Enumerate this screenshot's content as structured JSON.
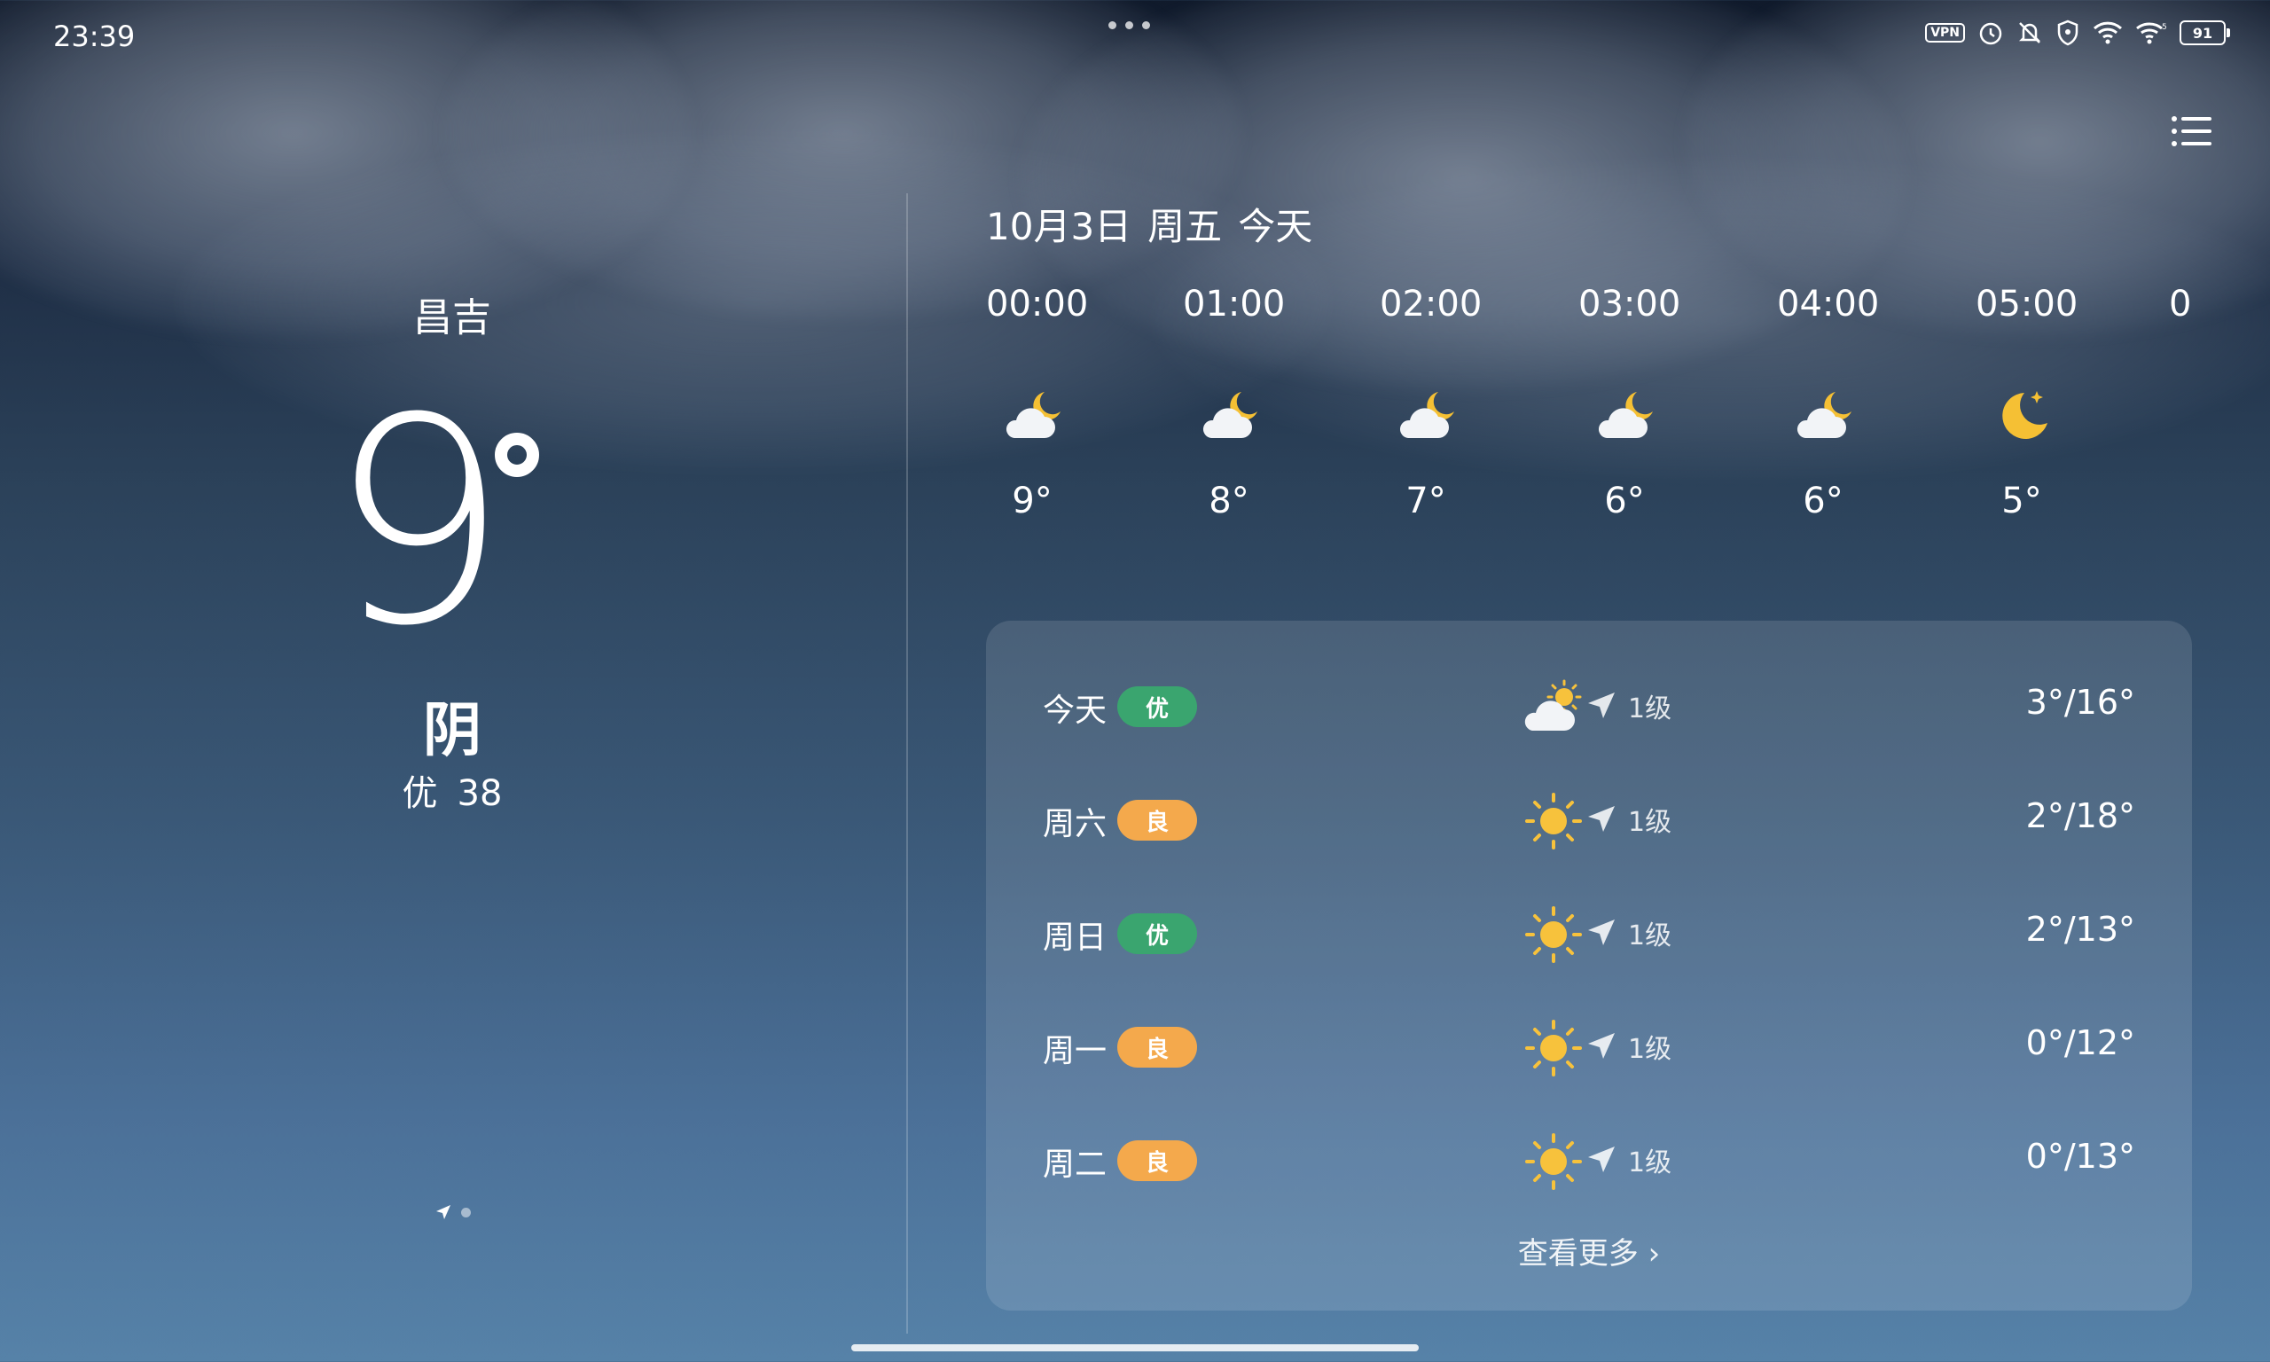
{
  "status_bar": {
    "time": "23:39",
    "battery": "91",
    "vpn": "VPN",
    "icons": [
      "vpn-icon",
      "alarm-icon",
      "mute-icon",
      "shield-icon",
      "wifi-icon",
      "wifi-5g-icon",
      "battery-icon"
    ]
  },
  "current": {
    "city": "昌吉",
    "temperature": "9",
    "condition": "阴",
    "aqi_label": "优",
    "aqi_value": "38"
  },
  "date_header": {
    "date": "10月3日",
    "weekday": "周五",
    "relative": "今天"
  },
  "hourly": [
    {
      "time": "00:00",
      "icon": "partly-cloudy-night-icon",
      "temp": "9°"
    },
    {
      "time": "01:00",
      "icon": "partly-cloudy-night-icon",
      "temp": "8°"
    },
    {
      "time": "02:00",
      "icon": "partly-cloudy-night-icon",
      "temp": "7°"
    },
    {
      "time": "03:00",
      "icon": "partly-cloudy-night-icon",
      "temp": "6°"
    },
    {
      "time": "04:00",
      "icon": "partly-cloudy-night-icon",
      "temp": "6°"
    },
    {
      "time": "05:00",
      "icon": "moon-icon",
      "temp": "5°"
    },
    {
      "time": "0",
      "icon": "",
      "temp": ""
    }
  ],
  "forecast": [
    {
      "day": "今天",
      "aqi": "优",
      "aqi_level": "good",
      "icon": "partly-cloudy-day-icon",
      "wind": "1级",
      "range": "3°/16°"
    },
    {
      "day": "周六",
      "aqi": "良",
      "aqi_level": "fair",
      "icon": "sun-icon",
      "wind": "1级",
      "range": "2°/18°"
    },
    {
      "day": "周日",
      "aqi": "优",
      "aqi_level": "good",
      "icon": "sun-icon",
      "wind": "1级",
      "range": "2°/13°"
    },
    {
      "day": "周一",
      "aqi": "良",
      "aqi_level": "fair",
      "icon": "sun-icon",
      "wind": "1级",
      "range": "0°/12°"
    },
    {
      "day": "周二",
      "aqi": "良",
      "aqi_level": "fair",
      "icon": "sun-icon",
      "wind": "1级",
      "range": "0°/13°"
    }
  ],
  "more_label": "查看更多",
  "colors": {
    "aqi_good": "#3aa56f",
    "aqi_fair": "#f4a94c",
    "sun": "#f7c23c",
    "moon": "#f5c034"
  }
}
